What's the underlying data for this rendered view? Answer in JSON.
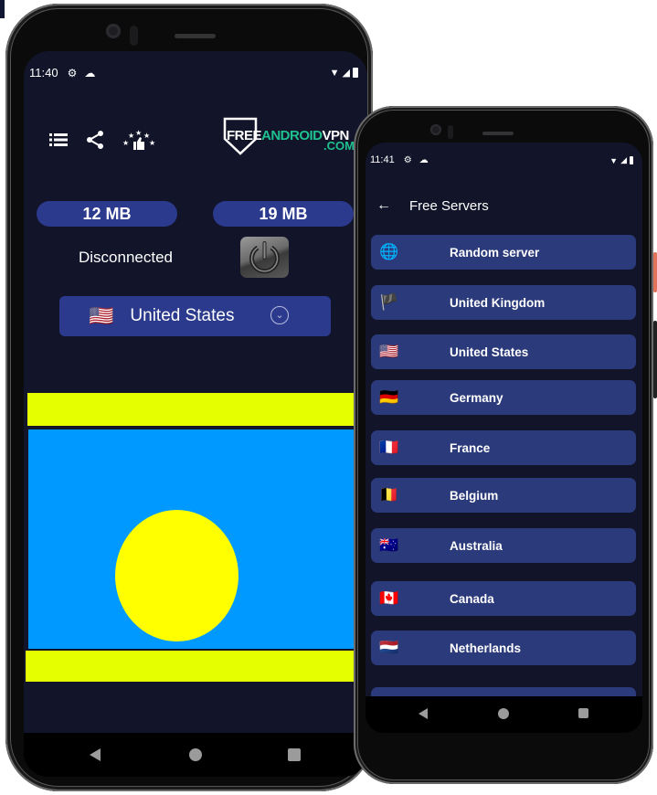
{
  "phone1": {
    "status_bar": {
      "time": "11:40",
      "icons": [
        "gear-icon",
        "cloud-icon"
      ],
      "right_icons": [
        "wifi-icon",
        "signal-icon",
        "battery-icon"
      ]
    },
    "toolbar": {
      "icons": [
        "menu-list-icon",
        "share-icon",
        "rate-stars-thumb-icon"
      ]
    },
    "logo": {
      "part1": "FREE",
      "part2": "ANDROID",
      "part3": "VPN",
      "part4": ".COM"
    },
    "traffic": {
      "download": "12 MB",
      "upload": "19 MB"
    },
    "connection": {
      "status": "Disconnected",
      "power_button": "power-icon"
    },
    "selected_country": {
      "flag": "🇺🇸",
      "name": "United States"
    },
    "flag_display": {
      "country": "Palau",
      "colors": {
        "band": "#e6ff00",
        "field": "#0099ff",
        "disc": "#ffff00"
      }
    },
    "nav": [
      "back",
      "home",
      "recents"
    ]
  },
  "phone2": {
    "status_bar": {
      "time": "11:41",
      "icons": [
        "gear-icon",
        "cloud-icon"
      ],
      "right_icons": [
        "wifi-icon",
        "signal-icon",
        "battery-icon"
      ]
    },
    "header": {
      "title": "Free Servers",
      "back_icon": "arrow-left-icon"
    },
    "servers": [
      {
        "flag": "🌐",
        "label": "Random server"
      },
      {
        "flag": "🏴",
        "label": "United Kingdom"
      },
      {
        "flag": "🇺🇸",
        "label": "United States"
      },
      {
        "flag": "🇩🇪",
        "label": "Germany"
      },
      {
        "flag": "🇫🇷",
        "label": "France"
      },
      {
        "flag": "🇧🇪",
        "label": "Belgium"
      },
      {
        "flag": "🇦🇺",
        "label": "Australia"
      },
      {
        "flag": "🇨🇦",
        "label": "Canada"
      },
      {
        "flag": "🇳🇱",
        "label": "Netherlands"
      }
    ],
    "nav": [
      "back",
      "home",
      "recents"
    ]
  },
  "colors": {
    "background": "#12142a",
    "accent": "#2b3a8c",
    "list_item": "#2b3a7a",
    "brand_green": "#1fc28e"
  }
}
